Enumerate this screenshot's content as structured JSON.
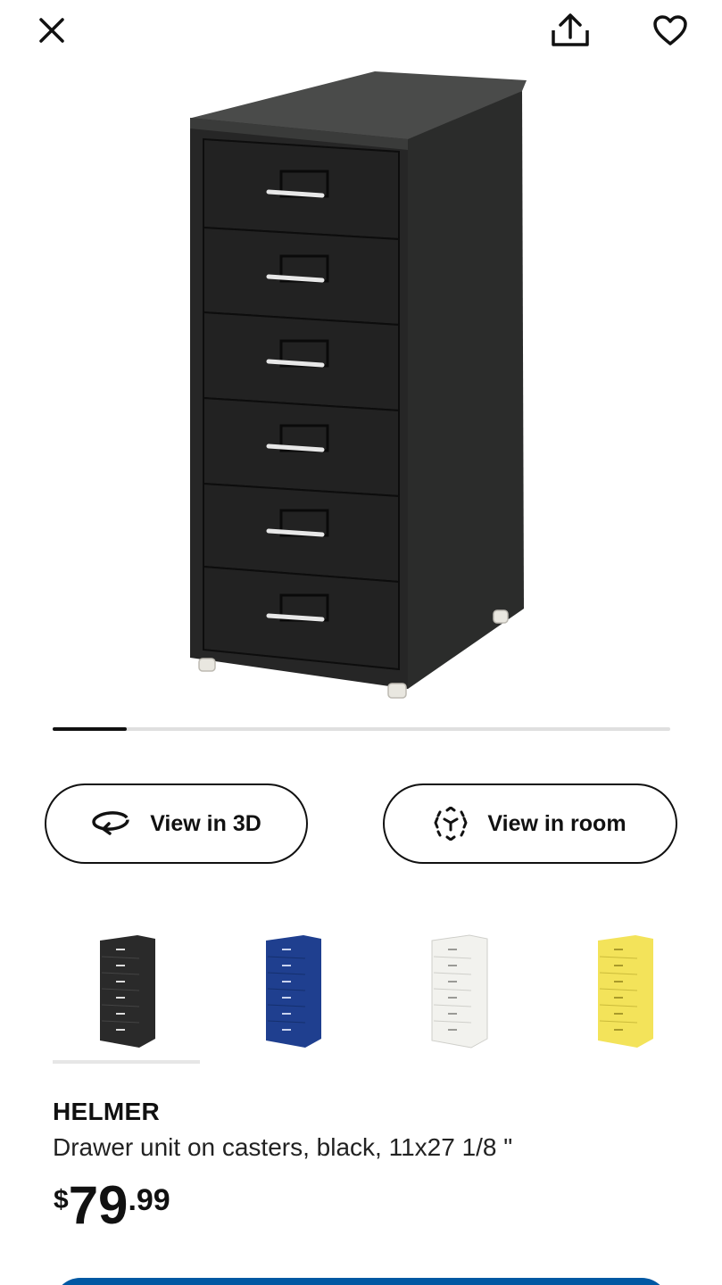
{
  "toolbar": {
    "close_icon": "close-icon",
    "share_icon": "share-icon",
    "favorite_icon": "heart-icon"
  },
  "gallery": {
    "image_count_progress": 0.12
  },
  "actions": {
    "view_3d_label": "View in 3D",
    "view_room_label": "View in room"
  },
  "variants": [
    {
      "color": "black",
      "hex": "#2a2a2a",
      "selected": true
    },
    {
      "color": "blue",
      "hex": "#1f3f8f",
      "selected": false
    },
    {
      "color": "white",
      "hex": "#f2f2ee",
      "selected": false
    },
    {
      "color": "yellow",
      "hex": "#f3e35a",
      "selected": false
    }
  ],
  "product": {
    "name": "HELMER",
    "description": "Drawer unit on casters, black, 11x27 1/8 \"",
    "price_currency": "$",
    "price_integer": "79",
    "price_decimal": ".99"
  },
  "colors": {
    "accent": "#0058a3",
    "text": "#111111"
  }
}
